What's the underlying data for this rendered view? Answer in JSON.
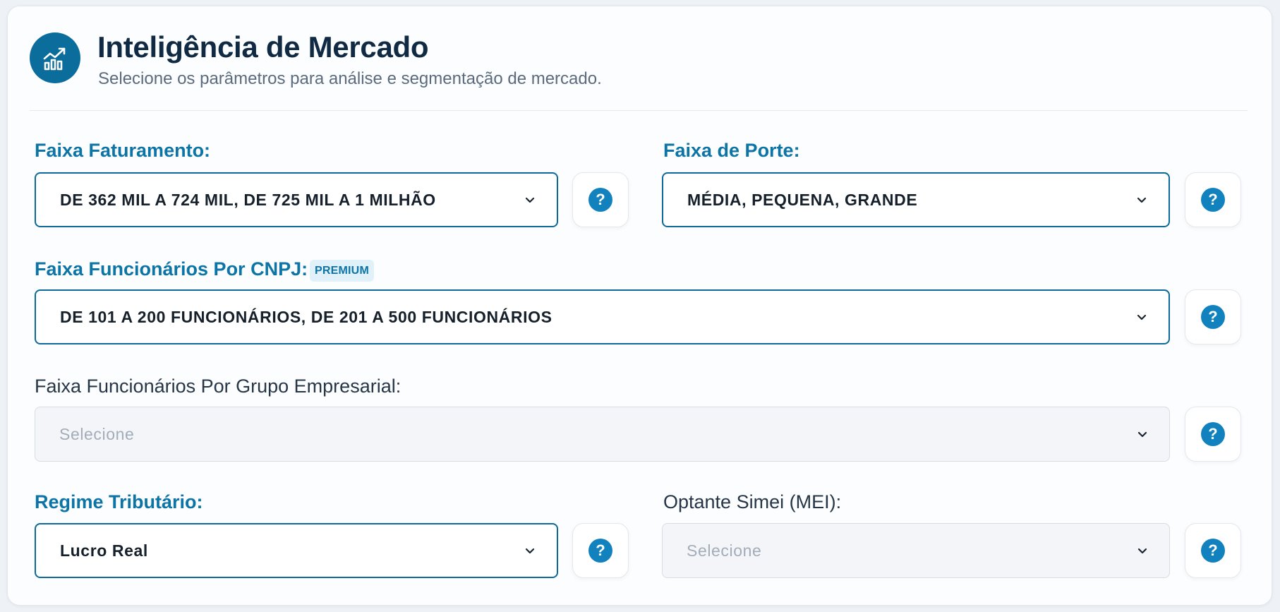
{
  "header": {
    "icon": "chart-growth-icon",
    "title": "Inteligência de Mercado",
    "subtitle": "Selecione os parâmetros para análise e segmentação de mercado."
  },
  "colors": {
    "accent": "#0d74a6",
    "icon_bg": "#0b6d9c",
    "help_icon": "#1182bd",
    "title": "#102a43"
  },
  "fields": {
    "faturamento": {
      "label": "Faixa Faturamento:",
      "value": "DE 362 MIL A 724 MIL, DE 725 MIL A 1 MILHÃO",
      "help": "?"
    },
    "porte": {
      "label": "Faixa de Porte:",
      "value": "MÉDIA, PEQUENA, GRANDE",
      "help": "?"
    },
    "funcionarios_cnpj": {
      "label": "Faixa Funcionários Por CNPJ:",
      "badge": "PREMIUM",
      "value": "DE 101 A 200 FUNCIONÁRIOS, DE 201 A 500 FUNCIONÁRIOS",
      "help": "?"
    },
    "funcionarios_grupo": {
      "label": "Faixa Funcionários Por Grupo Empresarial:",
      "placeholder": "Selecione",
      "help": "?"
    },
    "regime": {
      "label": "Regime Tributário:",
      "value": "Lucro Real",
      "help": "?"
    },
    "simei": {
      "label": "Optante Simei (MEI):",
      "placeholder": "Selecione",
      "help": "?"
    }
  }
}
